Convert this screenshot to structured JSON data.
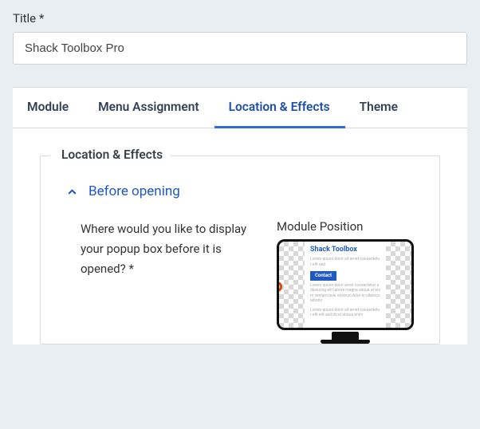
{
  "title": {
    "label": "Title *",
    "value": "Shack Toolbox Pro"
  },
  "tabs": [
    {
      "label": "Module"
    },
    {
      "label": "Menu Assignment"
    },
    {
      "label": "Location & Effects"
    },
    {
      "label": "Theme"
    }
  ],
  "fieldset": {
    "legend": "Location & Effects"
  },
  "accordion": {
    "header": "Before opening"
  },
  "question": "Where would you like to display your popup box before it is opened? *",
  "position": {
    "label": "Module Position",
    "preview_title": "Shack Toolbox",
    "preview_button": "Contact"
  }
}
